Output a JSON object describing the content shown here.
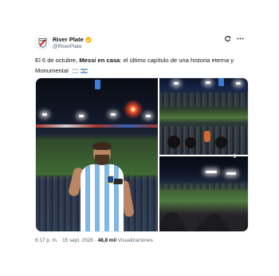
{
  "post": {
    "author": {
      "display_name": "River Plate",
      "handle": "@RiverPlate",
      "verified": true,
      "avatar_icon": "river-plate-crest-icon"
    },
    "actions": {
      "grok_icon": "grok-icon",
      "more_icon": "more-icon"
    },
    "text": {
      "part1": "El 6 de octubre, ",
      "bold": "Messi en casa",
      "part2": ": el último capítulo de una historia eterna y Monumental"
    },
    "media": {
      "count": 3,
      "next_icon": "arrow-right-icon"
    },
    "meta": {
      "time": "6:17 p. m.",
      "separator": "·",
      "date": "15 sept. 2026",
      "views_count": "48,8 mil",
      "views_label": "Visualizaciones"
    }
  },
  "colors": {
    "text": "#0f1419",
    "secondary": "#536471",
    "verified": "#f7b500",
    "brand_red": "#e1232b"
  }
}
